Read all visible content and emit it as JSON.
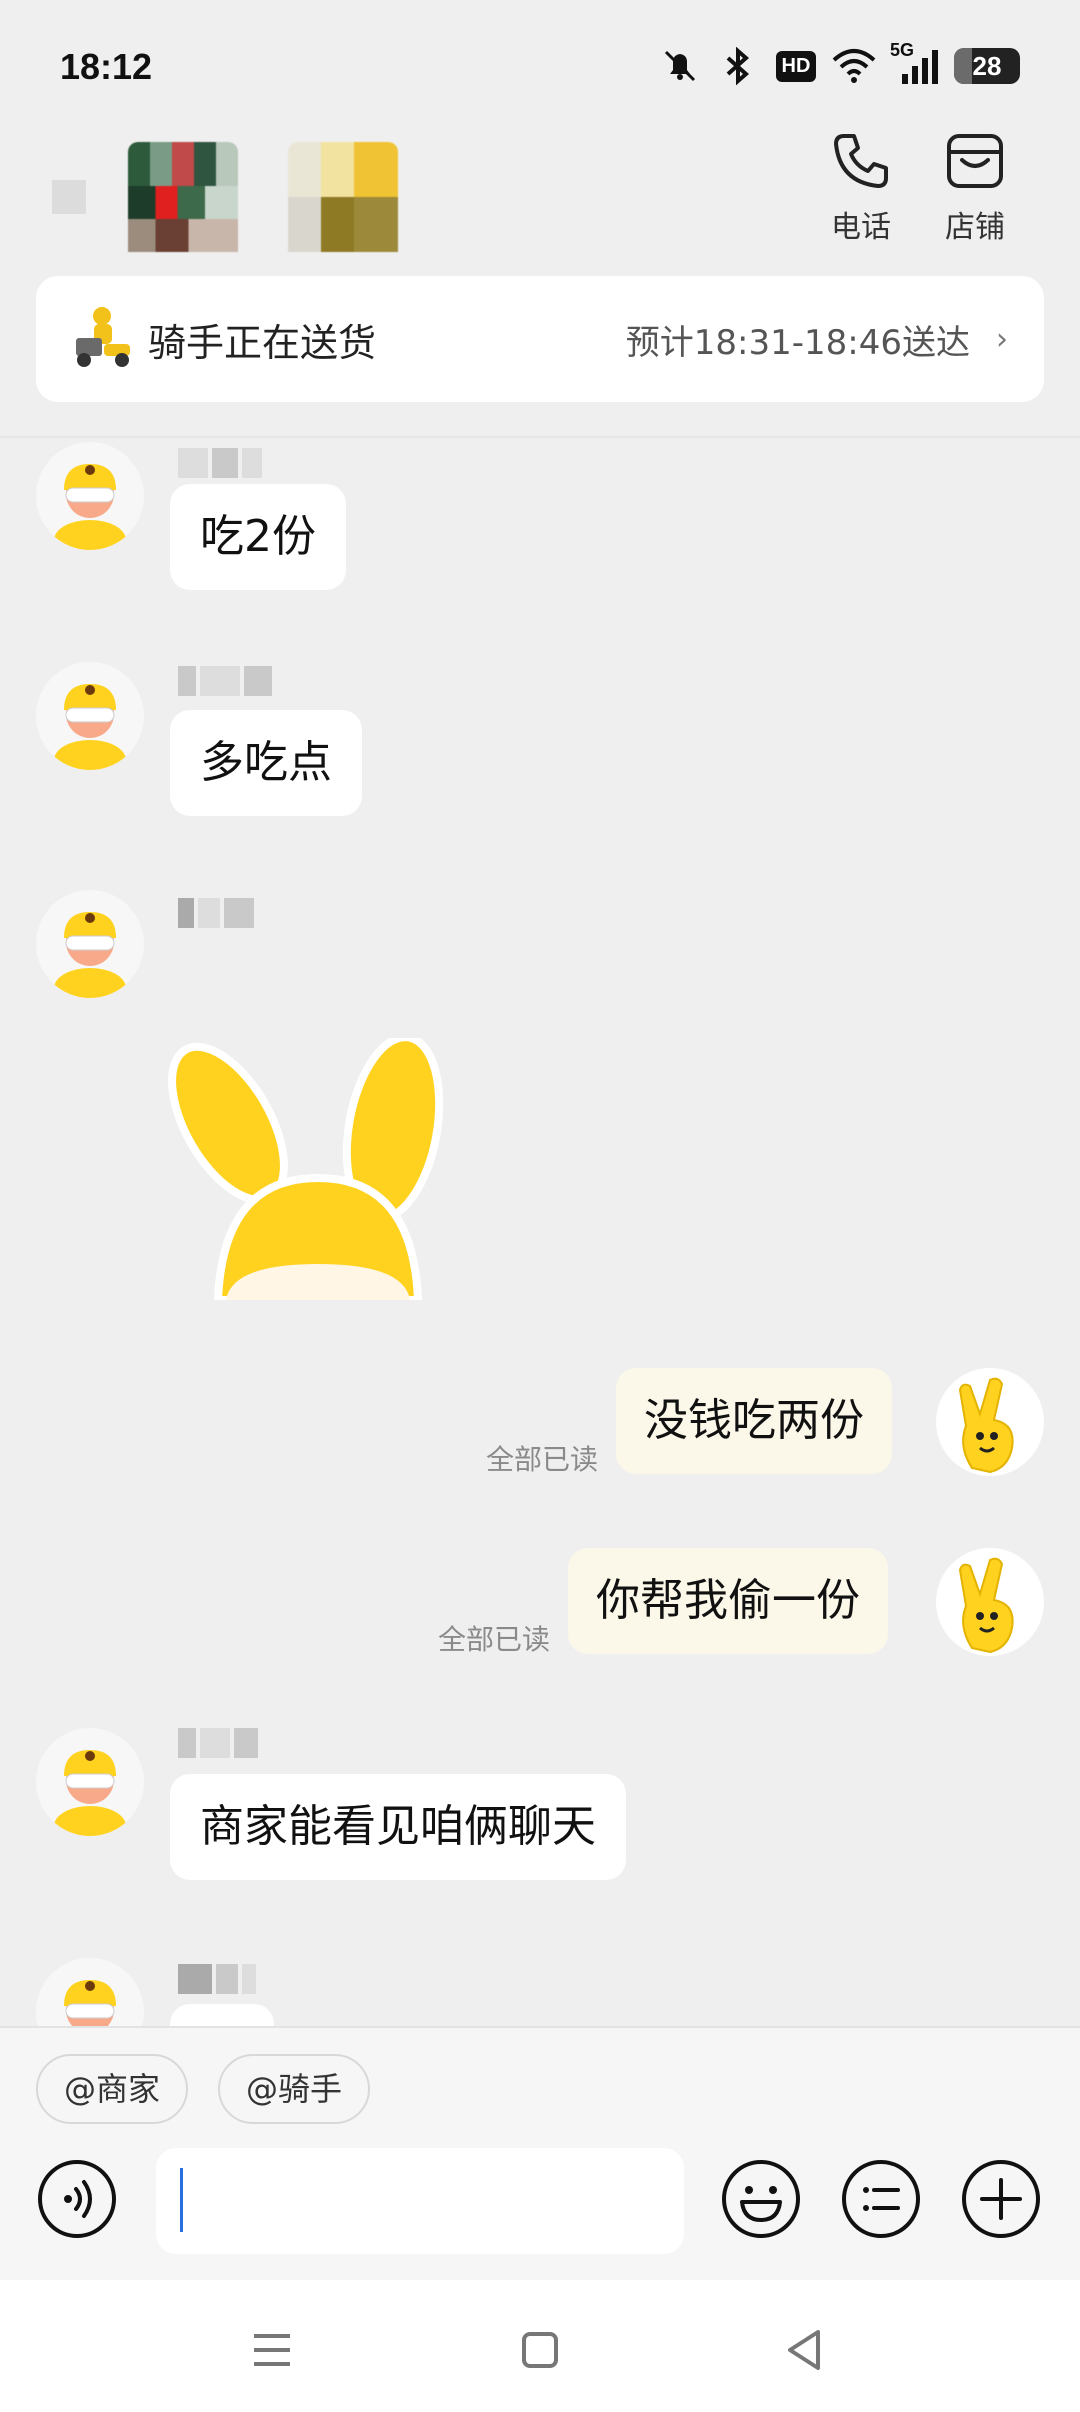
{
  "status_bar": {
    "time": "18:12",
    "network": "5G",
    "hd": "HD",
    "battery": "28",
    "battery_level": 0.28
  },
  "header": {
    "phone_label": "电话",
    "shop_label": "店铺"
  },
  "delivery": {
    "status": "骑手正在送货",
    "eta": "预计18:31-18:46送达"
  },
  "messages": [
    {
      "text": "吃2份"
    },
    {
      "text": "多吃点"
    },
    {
      "sticker": "bunny-ears-sticker"
    },
    {
      "text": "没钱吃两份",
      "read": "全部已读"
    },
    {
      "text": "你帮我偷一份",
      "read": "全部已读"
    },
    {
      "text": "商家能看见咱俩聊天"
    }
  ],
  "quick_mentions": [
    "@商家",
    "@骑手"
  ],
  "colors": {
    "brand_yellow": "#ffd21f",
    "outgoing_bubble": "#fbf8ea",
    "background": "#efefef"
  }
}
